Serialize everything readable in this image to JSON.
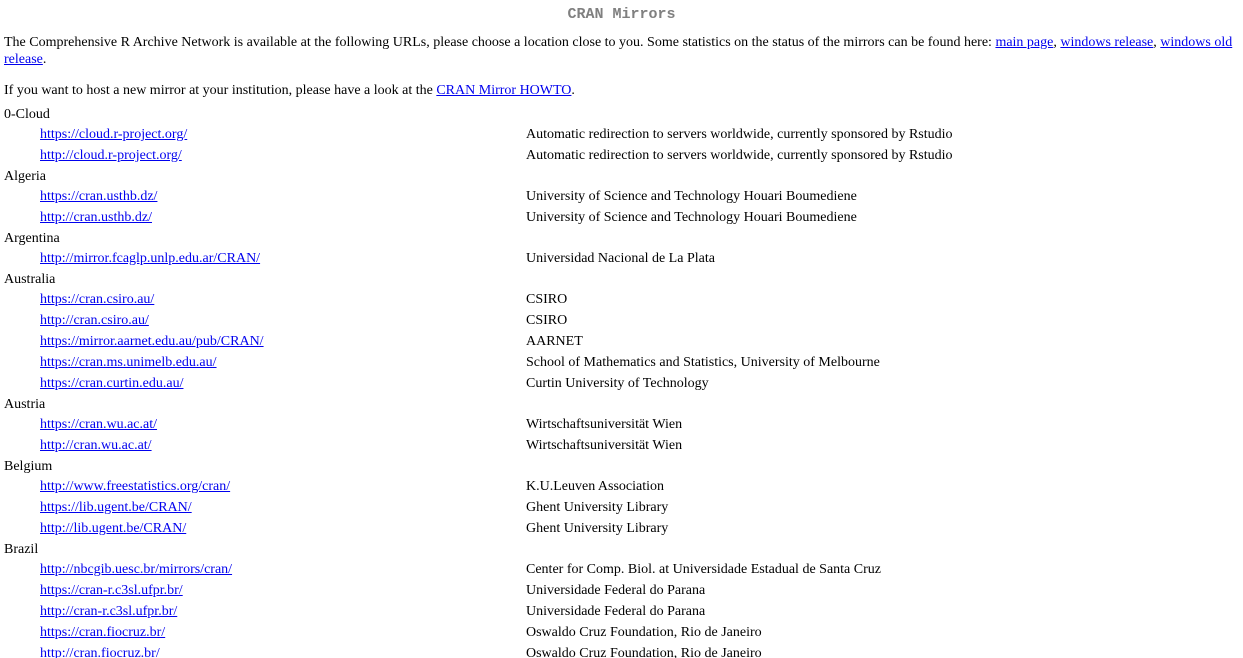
{
  "page": {
    "title": "CRAN Mirrors",
    "intro_text": "The Comprehensive R Archive Network is available at the following URLs, please choose a location close to you. Some statistics on the status of the mirrors can be found here: ",
    "intro_link_main": "main page",
    "intro_sep1": ", ",
    "intro_link_windows": "windows release",
    "intro_sep2": ", ",
    "intro_link_windows_old": "windows old release",
    "intro_end": ".",
    "host_text": "If you want to host a new mirror at your institution, please have a look at the ",
    "host_link": "CRAN Mirror HOWTO",
    "host_end": "."
  },
  "countries": [
    {
      "name": "0-Cloud",
      "mirrors": [
        {
          "url": "https://cloud.r-project.org/",
          "desc": "Automatic redirection to servers worldwide, currently sponsored by Rstudio"
        },
        {
          "url": "http://cloud.r-project.org/",
          "desc": "Automatic redirection to servers worldwide, currently sponsored by Rstudio"
        }
      ]
    },
    {
      "name": "Algeria",
      "mirrors": [
        {
          "url": "https://cran.usthb.dz/",
          "desc": "University of Science and Technology Houari Boumediene"
        },
        {
          "url": "http://cran.usthb.dz/",
          "desc": "University of Science and Technology Houari Boumediene"
        }
      ]
    },
    {
      "name": "Argentina",
      "mirrors": [
        {
          "url": "http://mirror.fcaglp.unlp.edu.ar/CRAN/",
          "desc": "Universidad Nacional de La Plata"
        }
      ]
    },
    {
      "name": "Australia",
      "mirrors": [
        {
          "url": "https://cran.csiro.au/",
          "desc": "CSIRO"
        },
        {
          "url": "http://cran.csiro.au/",
          "desc": "CSIRO"
        },
        {
          "url": "https://mirror.aarnet.edu.au/pub/CRAN/",
          "desc": "AARNET"
        },
        {
          "url": "https://cran.ms.unimelb.edu.au/",
          "desc": "School of Mathematics and Statistics, University of Melbourne"
        },
        {
          "url": "https://cran.curtin.edu.au/",
          "desc": "Curtin University of Technology"
        }
      ]
    },
    {
      "name": "Austria",
      "mirrors": [
        {
          "url": "https://cran.wu.ac.at/",
          "desc": "Wirtschaftsuniversität Wien"
        },
        {
          "url": "http://cran.wu.ac.at/",
          "desc": "Wirtschaftsuniversität Wien"
        }
      ]
    },
    {
      "name": "Belgium",
      "mirrors": [
        {
          "url": "http://www.freestatistics.org/cran/",
          "desc": "K.U.Leuven Association"
        },
        {
          "url": "https://lib.ugent.be/CRAN/",
          "desc": "Ghent University Library"
        },
        {
          "url": "http://lib.ugent.be/CRAN/",
          "desc": "Ghent University Library"
        }
      ]
    },
    {
      "name": "Brazil",
      "mirrors": [
        {
          "url": "http://nbcgib.uesc.br/mirrors/cran/",
          "desc": "Center for Comp. Biol. at Universidade Estadual de Santa Cruz"
        },
        {
          "url": "https://cran-r.c3sl.ufpr.br/",
          "desc": "Universidade Federal do Parana"
        },
        {
          "url": "http://cran-r.c3sl.ufpr.br/",
          "desc": "Universidade Federal do Parana"
        },
        {
          "url": "https://cran.fiocruz.br/",
          "desc": "Oswaldo Cruz Foundation, Rio de Janeiro"
        },
        {
          "url": "http://cran.fiocruz.br/",
          "desc": "Oswaldo Cruz Foundation, Rio de Janeiro"
        }
      ]
    }
  ]
}
